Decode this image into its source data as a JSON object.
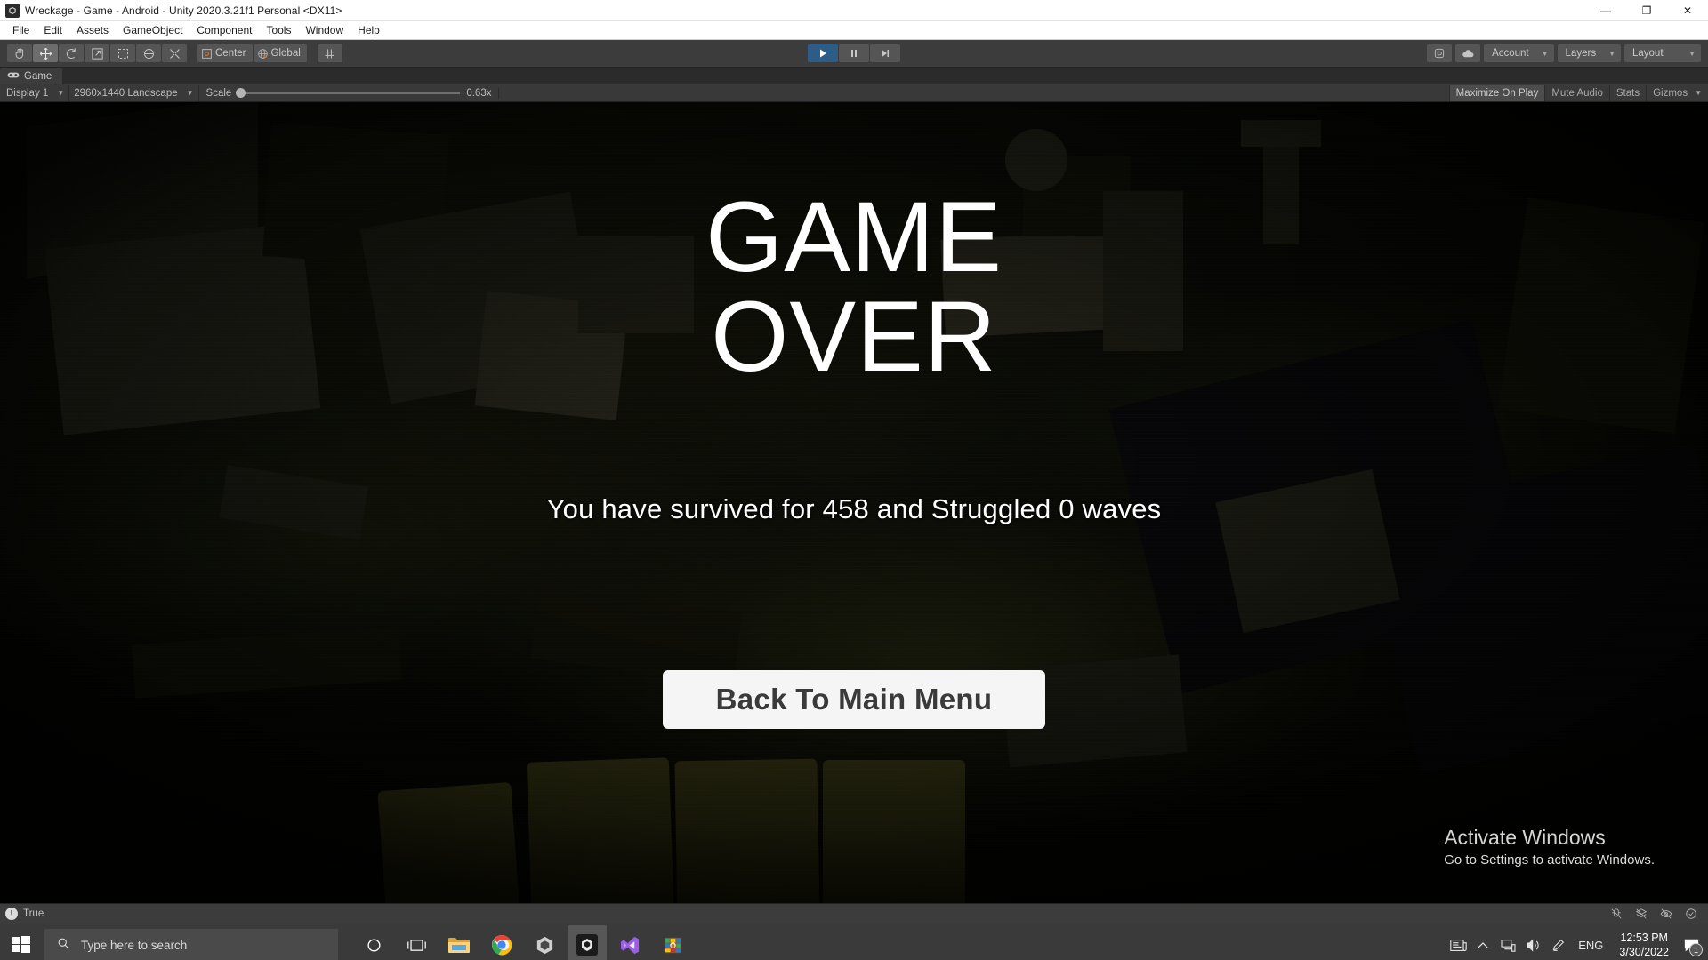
{
  "window": {
    "icon": "unity-icon",
    "title": "Wreckage - Game - Android - Unity 2020.3.21f1 Personal <DX11>",
    "controls": {
      "minimize": "—",
      "restore": "❐",
      "close": "✕"
    }
  },
  "menubar": {
    "items": [
      "File",
      "Edit",
      "Assets",
      "GameObject",
      "Component",
      "Tools",
      "Window",
      "Help"
    ]
  },
  "toolbar": {
    "tools": [
      {
        "name": "hand-tool",
        "selected": false
      },
      {
        "name": "move-tool",
        "selected": true
      },
      {
        "name": "rotate-tool",
        "selected": false
      },
      {
        "name": "scale-tool",
        "selected": false
      },
      {
        "name": "rect-tool",
        "selected": false
      },
      {
        "name": "transform-tool",
        "selected": false
      },
      {
        "name": "custom-tool",
        "selected": false
      }
    ],
    "pivot_mode": "Center",
    "pivot_rotation": "Global",
    "snap_tool": "grid-snap-icon",
    "play": "▶",
    "pause": "❙❙",
    "step": "▶❙",
    "play_active": true,
    "collab_label": "collab-icon",
    "cloud_label": "cloud-icon",
    "account": "Account",
    "layers": "Layers",
    "layout": "Layout"
  },
  "gameview": {
    "tab_label": "Game",
    "tab_icon": "gamepad-icon",
    "display": "Display 1",
    "resolution": "2960x1440 Landscape",
    "scale_label": "Scale",
    "scale_value": "0.63x",
    "scale_percent": 0,
    "maximize_on_play": "Maximize On Play",
    "mute_audio": "Mute Audio",
    "stats": "Stats",
    "gizmos": "Gizmos"
  },
  "game_overlay": {
    "title_line1": "GAME",
    "title_line2": "OVER",
    "survived_text": "You have survived for 458 and Struggled 0 waves",
    "survived_seconds": "458",
    "waves": "0",
    "button_label": "Back To Main Menu",
    "watermark_title": "Activate Windows",
    "watermark_subtitle": "Go to Settings to activate Windows."
  },
  "statusbar": {
    "message": "True",
    "message_icon": "console-info-icon",
    "right_icons": [
      "debug-off-icon",
      "layers-off-icon",
      "eye-off-icon",
      "check-circle-icon"
    ]
  },
  "taskbar": {
    "start": "windows-start-icon",
    "search_placeholder": "Type here to search",
    "apps": [
      {
        "name": "cortana-icon",
        "active": false,
        "running": false
      },
      {
        "name": "task-view-icon",
        "active": false,
        "running": false
      },
      {
        "name": "file-explorer-icon",
        "active": false,
        "running": true
      },
      {
        "name": "chrome-icon",
        "active": false,
        "running": true
      },
      {
        "name": "unity-hub-icon",
        "active": false,
        "running": true
      },
      {
        "name": "unity-editor-icon",
        "active": true,
        "running": true
      },
      {
        "name": "visual-studio-icon",
        "active": false,
        "running": true
      },
      {
        "name": "winrar-icon",
        "active": false,
        "running": false
      }
    ],
    "tray": {
      "news_icon": "news-and-interests-icon",
      "chevron": "∧",
      "network_icon": "network-icon",
      "volume_icon": "volume-icon",
      "pen_icon": "pen-icon",
      "language": "ENG",
      "time": "12:53 PM",
      "date": "3/30/2022",
      "notification_count": "1"
    }
  },
  "colors": {
    "unity_chrome": "#3c3c3c",
    "unity_dark": "#2b2b2b",
    "play_active": "#2b5d88",
    "taskbar": "#3a3a3a",
    "button_bg": "#f5f5f5",
    "button_text": "#3a3a3a",
    "overlay_text": "#ffffff"
  }
}
